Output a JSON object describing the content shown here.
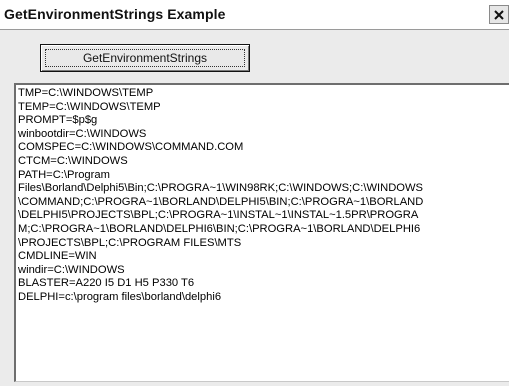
{
  "window": {
    "title": "GetEnvironmentStrings Example",
    "close_glyph": "×",
    "close_icon": "close-icon"
  },
  "button": {
    "label": "GetEnvironmentStrings"
  },
  "memo": {
    "lines": [
      "TMP=C:\\WINDOWS\\TEMP",
      "TEMP=C:\\WINDOWS\\TEMP",
      "PROMPT=$p$g",
      "winbootdir=C:\\WINDOWS",
      "COMSPEC=C:\\WINDOWS\\COMMAND.COM",
      "CTCM=C:\\WINDOWS",
      "PATH=C:\\Program",
      "Files\\Borland\\Delphi5\\Bin;C:\\PROGRA~1\\WIN98RK;C:\\WINDOWS;C:\\WINDOWS",
      "\\COMMAND;C:\\PROGRA~1\\BORLAND\\DELPHI5\\BIN;C:\\PROGRA~1\\BORLAND",
      "\\DELPHI5\\PROJECTS\\BPL;C:\\PROGRA~1\\INSTAL~1\\INSTAL~1.5PR\\PROGRA",
      "M;C:\\PROGRA~1\\BORLAND\\DELPHI6\\BIN;C:\\PROGRA~1\\BORLAND\\DELPHI6",
      "\\PROJECTS\\BPL;C:\\PROGRAM FILES\\MTS",
      "CMDLINE=WIN",
      "windir=C:\\WINDOWS",
      "BLASTER=A220 I5 D1 H5 P330 T6",
      "DELPHI=c:\\program files\\borland\\delphi6"
    ]
  }
}
